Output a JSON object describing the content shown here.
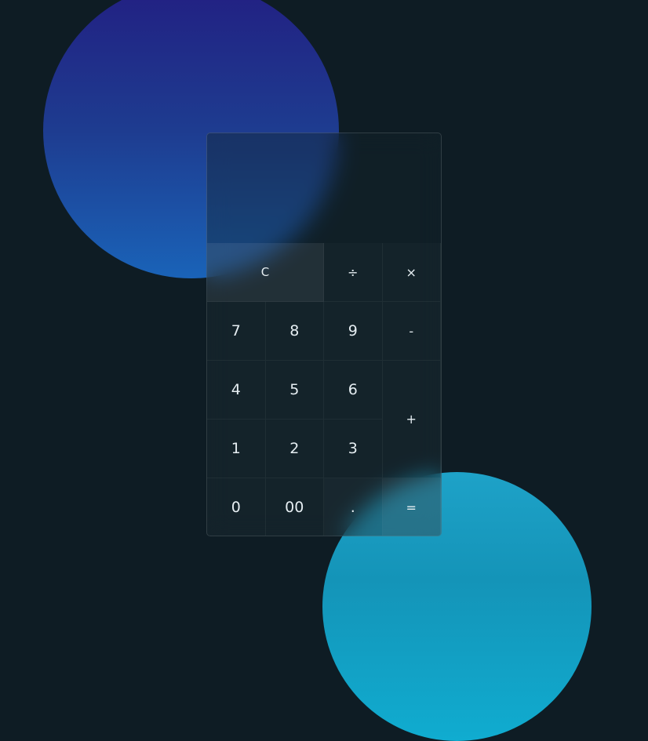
{
  "colors": {
    "background": "#0e1c24",
    "blob_top_gradient": [
      "#221f82",
      "#1a63b8"
    ],
    "blob_bottom_gradient": [
      "#1ea2c8",
      "#10acd0"
    ]
  },
  "display": {
    "value": ""
  },
  "keys": {
    "clear": "C",
    "divide": "÷",
    "multiply": "×",
    "seven": "7",
    "eight": "8",
    "nine": "9",
    "minus": "-",
    "four": "4",
    "five": "5",
    "six": "6",
    "plus": "+",
    "one": "1",
    "two": "2",
    "three": "3",
    "zero": "0",
    "double_zero": "00",
    "decimal": ".",
    "equals": "="
  }
}
